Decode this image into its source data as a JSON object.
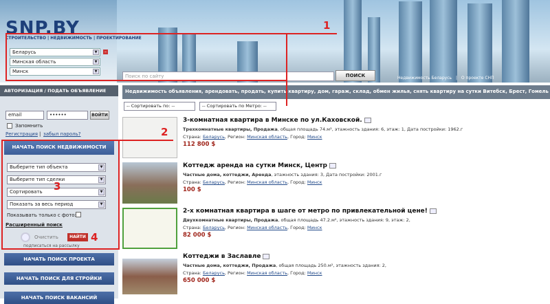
{
  "header": {
    "logo": "SNP.BY",
    "logo_sub": "СТРОИТЕЛЬСТВО | НЕДВИЖИМОСТЬ | ПРОЕКТИРОВАНИЕ",
    "search_placeholder": "Поиск по сайту",
    "search_button": "ПОИСК",
    "link1": "Недвижимость Беларусь",
    "sep": "|",
    "link2": "О проекте СНП"
  },
  "regions": {
    "country": "Беларусь",
    "oblast": "Минская область",
    "city": "Минск"
  },
  "login": {
    "header": "АВТОРИЗАЦИЯ / ПОДАТЬ ОБЪЯВЛЕНИЕ",
    "email": "email",
    "password": "••••••",
    "enter": "ВОЙТИ",
    "remember": "Запомнить",
    "register": "Регистрация",
    "forgot": "забыл пароль?",
    "sep": "|"
  },
  "filter": {
    "start": "НАЧАТЬ ПОИСК НЕДВИЖИМОСТИ",
    "type": "Выберите тип объекта",
    "deal": "Выберите тип сделки",
    "sort": "Сортировать",
    "period": "Показать за весь период",
    "photo": "Показывать только с фото:",
    "advanced": "Расширенный поиск",
    "clear": "Очистить",
    "find": "НАЙТИ",
    "subscribe": "подписаться на рассылку"
  },
  "buttons": {
    "project": "НАЧАТЬ ПОИСК ПРОЕКТА",
    "build": "НАЧАТЬ ПОИСК ДЛЯ СТРОЙКИ",
    "jobs": "НАЧАТЬ ПОИСК ВАКАНСИЙ"
  },
  "bar": "Недвижимость объявления, арендовать, продать, купить квартиру, дом, гараж, склад, обмен жилья, снять квартиру на сутки Витебск, Брест, Гомель",
  "sort": {
    "by": "-- Сортировать по: --",
    "metro": "-- Сортировать по Метро: --"
  },
  "annotations": [
    "1",
    "2",
    "3",
    "4"
  ],
  "listings": [
    {
      "title": "3-комнатная квартира в Минске по ул.Каховской.",
      "desc_bold": "Трехкомнатные квартиры, Продажа",
      "desc": ", общая площадь 74.м², этажность здания: 6, этаж: 1, Дата постройки: 1962.г",
      "country_l": "Страна:",
      "country": "Беларусь",
      "region_l": ", Регион:",
      "region": "Минская область",
      "city_l": ", Город:",
      "city": "Минск",
      "price": "112 800 $"
    },
    {
      "title": "Коттедж аренда на сутки Минск, Центр",
      "desc_bold": "Частные дома, коттеджи, Аренда",
      "desc": ", этажность здания: 3, Дата постройки: 2001.г",
      "country_l": "Страна:",
      "country": "Беларусь",
      "region_l": ", Регион:",
      "region": "Минская область",
      "city_l": ", Город:",
      "city": "Минск",
      "price": "100 $"
    },
    {
      "title": "2-х комнатная квартира в шаге от метро по привлекательной цене!",
      "desc_bold": "Двухкомнатные квартиры, Продажа",
      "desc": ", общая площадь 47.2.м², этажность здания: 9, этаж: 2,",
      "country_l": "Страна:",
      "country": "Беларусь",
      "region_l": ", Регион:",
      "region": "Минская область",
      "city_l": ", Город:",
      "city": "Минск",
      "price": "82 000 $"
    },
    {
      "title": "Коттеджи в Заславле",
      "desc_bold": "Частные дома, коттеджи, Продажа",
      "desc": ", общая площадь 250.м², этажность здания: 2,",
      "country_l": "Страна:",
      "country": "Беларусь",
      "region_l": ", Регион:",
      "region": "Минская область",
      "city_l": ", Город:",
      "city": "Минск",
      "price": "650 000 $"
    }
  ]
}
